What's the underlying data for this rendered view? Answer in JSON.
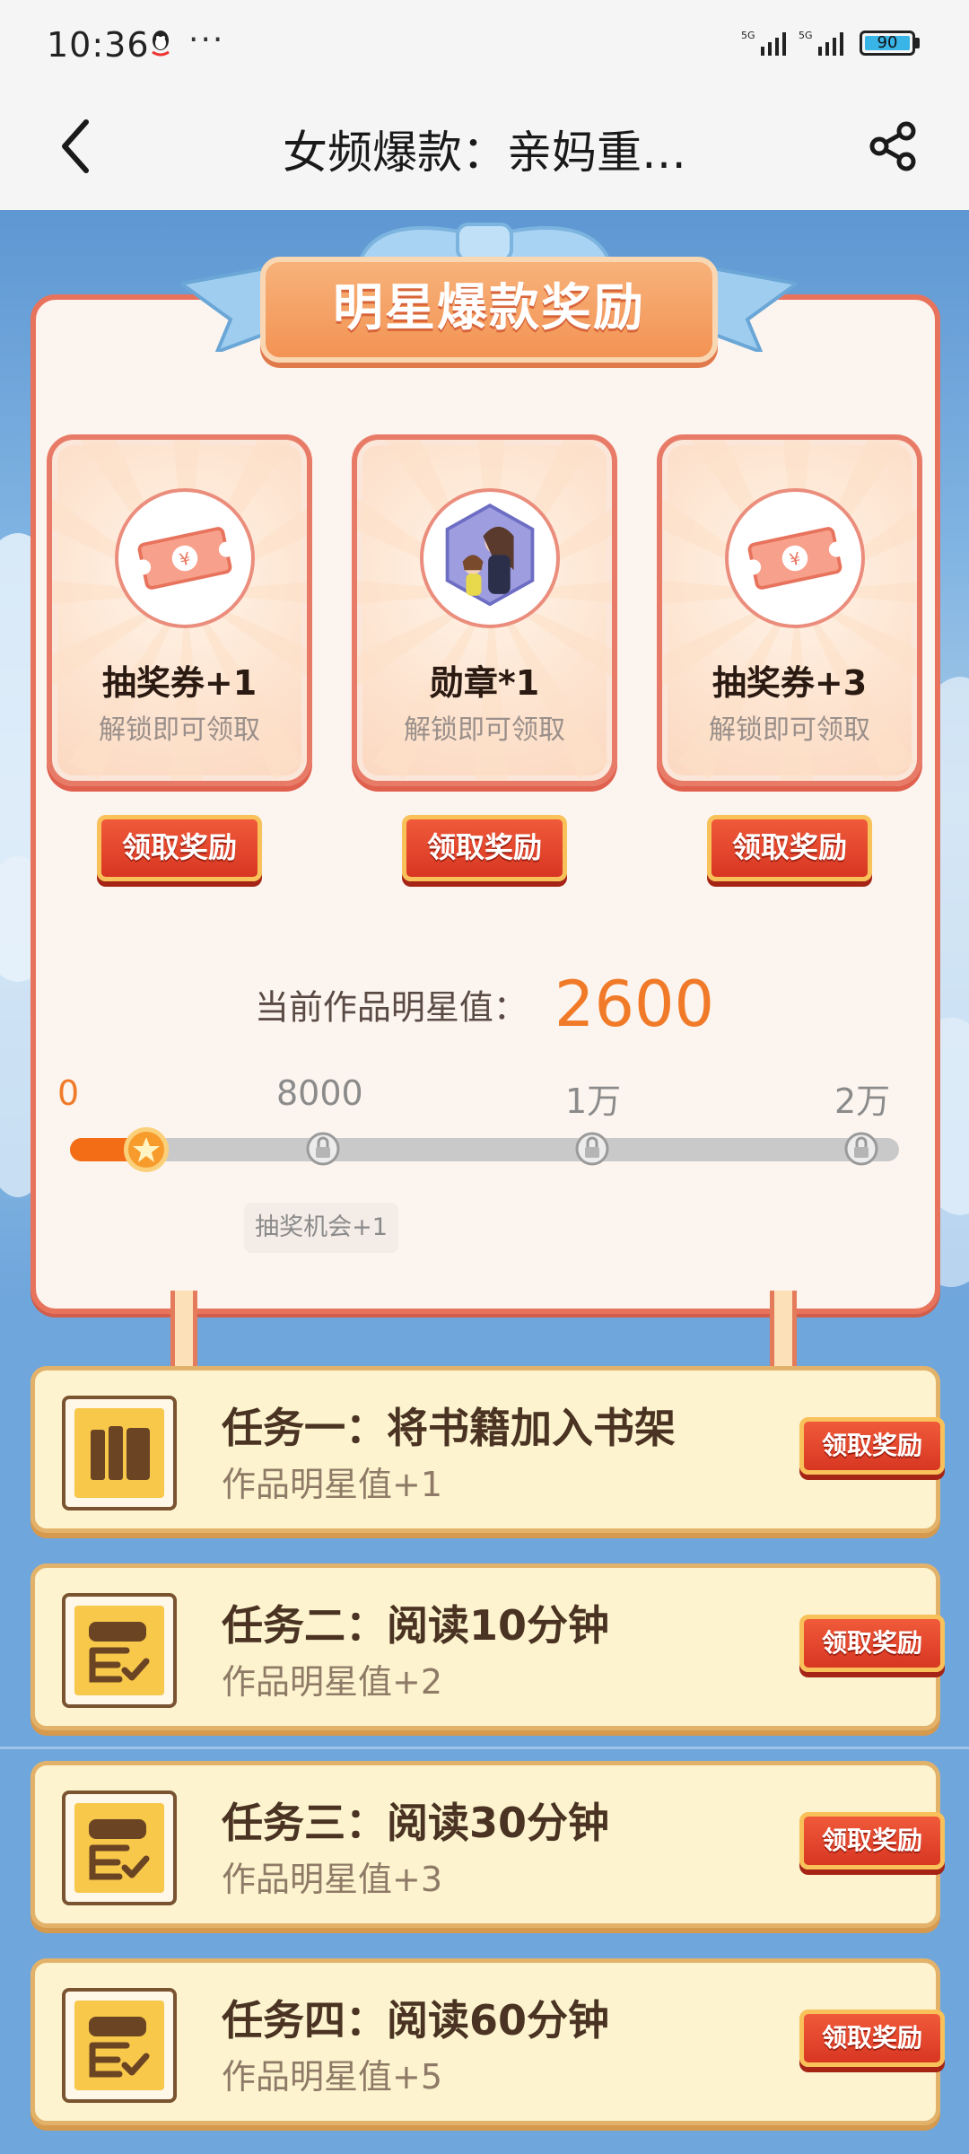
{
  "status_bar": {
    "time": "10:36",
    "battery": "90",
    "sim1": "5G",
    "sim2": "5G"
  },
  "header": {
    "title": "女频爆款：亲妈重…"
  },
  "banner": {
    "title": "明星爆款奖励"
  },
  "rewards": [
    {
      "name": "抽奖券+1",
      "sub": "解锁即可领取",
      "icon": "ticket-icon",
      "button": "领取奖励"
    },
    {
      "name": "勋章*1",
      "sub": "解锁即可领取",
      "icon": "medal-avatar-icon",
      "button": "领取奖励"
    },
    {
      "name": "抽奖券+3",
      "sub": "解锁即可领取",
      "icon": "ticket-icon",
      "button": "领取奖励"
    }
  ],
  "star": {
    "label": "当前作品明星值：",
    "value": "2600"
  },
  "progress": {
    "ticks": [
      "0",
      "8000",
      "1万",
      "2万"
    ],
    "current": 2600,
    "max": 20000,
    "hint": "抽奖机会+1"
  },
  "tasks": [
    {
      "title": "任务一：将书籍加入书架",
      "sub": "作品明星值+1",
      "button": "领取奖励",
      "icon": "book-icon"
    },
    {
      "title": "任务二：阅读10分钟",
      "sub": "作品明星值+2",
      "button": "领取奖励",
      "icon": "reading-check-icon"
    },
    {
      "title": "任务三：阅读30分钟",
      "sub": "作品明星值+3",
      "button": "领取奖励",
      "icon": "reading-check-icon"
    },
    {
      "title": "任务四：阅读60分钟",
      "sub": "作品明星值+5",
      "button": "领取奖励",
      "icon": "reading-check-icon"
    }
  ],
  "colors": {
    "accent": "#f07a28",
    "button": "#e0432a",
    "card_border": "#e8735d"
  }
}
